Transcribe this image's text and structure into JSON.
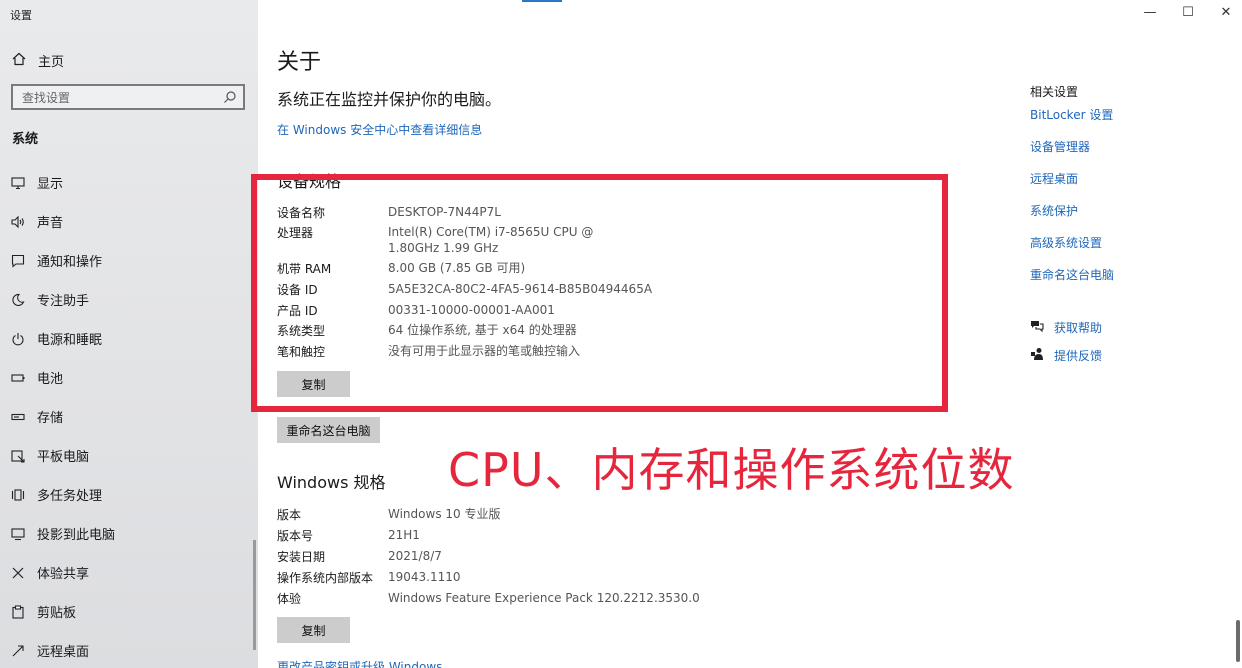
{
  "window": {
    "title": "设置",
    "controls": {
      "minimize": "—",
      "maximize": "☐",
      "close": "✕"
    }
  },
  "sidebar": {
    "home_label": "主页",
    "search_placeholder": "查找设置",
    "section": "系统",
    "items": [
      {
        "label": "显示",
        "icon": "monitor-icon"
      },
      {
        "label": "声音",
        "icon": "speaker-icon"
      },
      {
        "label": "通知和操作",
        "icon": "notification-icon"
      },
      {
        "label": "专注助手",
        "icon": "moon-icon"
      },
      {
        "label": "电源和睡眠",
        "icon": "power-icon"
      },
      {
        "label": "电池",
        "icon": "battery-icon"
      },
      {
        "label": "存储",
        "icon": "storage-icon"
      },
      {
        "label": "平板电脑",
        "icon": "tablet-icon"
      },
      {
        "label": "多任务处理",
        "icon": "multitask-icon"
      },
      {
        "label": "投影到此电脑",
        "icon": "project-icon"
      },
      {
        "label": "体验共享",
        "icon": "share-icon"
      },
      {
        "label": "剪贴板",
        "icon": "clipboard-icon"
      },
      {
        "label": "远程桌面",
        "icon": "remote-icon"
      }
    ]
  },
  "main": {
    "title": "关于",
    "subtitle": "系统正在监控并保护你的电脑。",
    "security_link": "在 Windows 安全中心中查看详细信息",
    "device_specs": {
      "heading": "设备规格",
      "rows": [
        {
          "key": "设备名称",
          "value": "DESKTOP-7N44P7L"
        },
        {
          "key": "处理器",
          "value": "Intel(R) Core(TM) i7-8565U CPU @ 1.80GHz   1.99 GHz"
        },
        {
          "key": "机带 RAM",
          "value": "8.00 GB (7.85 GB 可用)"
        },
        {
          "key": "设备 ID",
          "value": "5A5E32CA-80C2-4FA5-9614-B85B0494465A"
        },
        {
          "key": "产品 ID",
          "value": "00331-10000-00001-AA001"
        },
        {
          "key": "系统类型",
          "value": "64 位操作系统, 基于 x64 的处理器"
        },
        {
          "key": "笔和触控",
          "value": "没有可用于此显示器的笔或触控输入"
        }
      ],
      "copy_button": "复制",
      "rename_button": "重命名这台电脑"
    },
    "windows_specs": {
      "heading": "Windows 规格",
      "rows": [
        {
          "key": "版本",
          "value": "Windows 10 专业版"
        },
        {
          "key": "版本号",
          "value": "21H1"
        },
        {
          "key": "安装日期",
          "value": "2021/8/7"
        },
        {
          "key": "操作系统内部版本",
          "value": "19043.1110"
        },
        {
          "key": "体验",
          "value": "Windows Feature Experience Pack 120.2212.3530.0"
        }
      ],
      "copy_button": "复制",
      "bottom_link": "更改产品密钥或升级 Windows"
    },
    "annotation": "CPU、内存和操作系统位数"
  },
  "related": {
    "title": "相关设置",
    "links": [
      "BitLocker 设置",
      "设备管理器",
      "远程桌面",
      "系统保护",
      "高级系统设置",
      "重命名这台电脑"
    ],
    "help": [
      {
        "label": "获取帮助",
        "icon": "help-chat-icon"
      },
      {
        "label": "提供反馈",
        "icon": "feedback-icon"
      }
    ]
  },
  "colors": {
    "accent": "#1f67b8",
    "annotation_red": "#e5263d"
  }
}
